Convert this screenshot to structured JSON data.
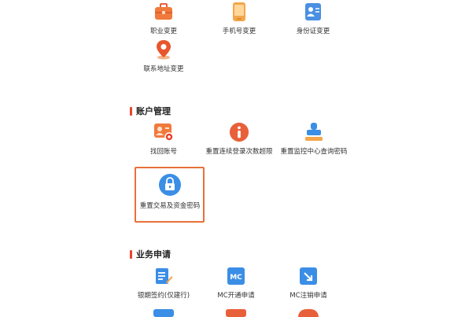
{
  "group1": {
    "items": [
      {
        "label": "职业变更",
        "icon": "briefcase-icon"
      },
      {
        "label": "手机号变更",
        "icon": "phone-icon"
      },
      {
        "label": "身份证变更",
        "icon": "id-card-icon"
      },
      {
        "label": "联系地址变更",
        "icon": "location-pin-icon"
      }
    ]
  },
  "account": {
    "title": "账户管理",
    "items": [
      {
        "label": "找回账号",
        "icon": "account-card-icon"
      },
      {
        "label": "重置连续登录次数超限",
        "icon": "info-icon"
      },
      {
        "label": "重置监控中心查询密码",
        "icon": "stamp-icon"
      },
      {
        "label": "重置交易及资金密码",
        "icon": "lock-icon"
      }
    ]
  },
  "business": {
    "title": "业务申请",
    "items": [
      {
        "label": "银期签约(仅建行)",
        "icon": "document-edit-icon"
      },
      {
        "label": "MC开通申请",
        "icon": "mc-chip-icon",
        "badge": "MC"
      },
      {
        "label": "MC注销申请",
        "icon": "mc-cancel-icon"
      }
    ]
  },
  "colors": {
    "accent": "#e8442e",
    "orange": "#f07a3c",
    "blue": "#3a8ee6",
    "highlight": "#e8703a"
  }
}
